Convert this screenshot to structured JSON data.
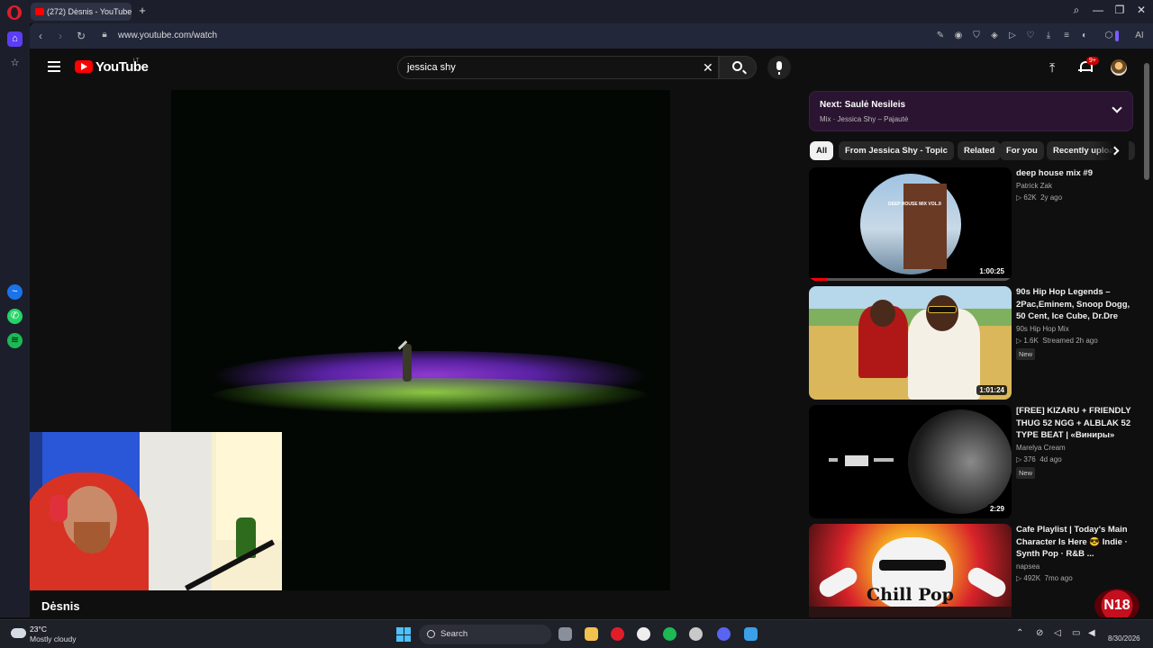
{
  "browser": {
    "tab_title": "(272) Dėsnis - YouTube",
    "new_tab": "+",
    "url": "www.youtube.com/watch",
    "ai_label": "AI",
    "minimize": "—",
    "restore": "❐",
    "close": "✕"
  },
  "youtube": {
    "logo_text": "YouTube",
    "country_code": "LT",
    "search_value": "jessica shy",
    "notifications_badge": "9+",
    "video_title": "Dėsnis",
    "more": "···"
  },
  "next": {
    "title": "Next: Saulė Nesileis",
    "subtitle": "Mix · Jessica Shy – Pajautė"
  },
  "chips": [
    "All",
    "From Jessica Shy - Topic",
    "Related",
    "For you",
    "Recently uploaded"
  ],
  "related": [
    {
      "title": "deep house mix #9",
      "channel": "Patrick Zak",
      "views": "▷ 62K",
      "age": "2y ago",
      "duration": "1:00:25",
      "badge": "",
      "thumb_label": "DEEP HOUSE MIX VOL.9"
    },
    {
      "title": "90s Hip Hop Legends – 2Pac,Eminem, Snoop Dogg, 50 Cent, Ice Cube, Dr.Dre",
      "channel": "90s Hip Hop Mix",
      "views": "▷ 1.6K",
      "age": "Streamed 2h ago",
      "duration": "1:01:24",
      "badge": "New"
    },
    {
      "title": "[FREE] KIZARU + FRIENDLY THUG 52 NGG + ALBLAK 52 TYPE BEAT | «Виниры»",
      "channel": "Marelya Cream",
      "views": "▷ 376",
      "age": "4d ago",
      "duration": "2:29",
      "badge": "New"
    },
    {
      "title": "Cafe Playlist | Today's Main Character Is Here 😎 Indie · Synth Pop · R&B ...",
      "channel": "napsea",
      "views": "▷ 492K",
      "age": "7mo ago",
      "duration": "",
      "badge": "",
      "thumb_label": "Chill Pop"
    }
  ],
  "overlay": {
    "logo": "N18"
  },
  "taskbar": {
    "temperature": "23°C",
    "condition": "Mostly cloudy",
    "search_label": "Search",
    "date": "8/30/2026"
  }
}
